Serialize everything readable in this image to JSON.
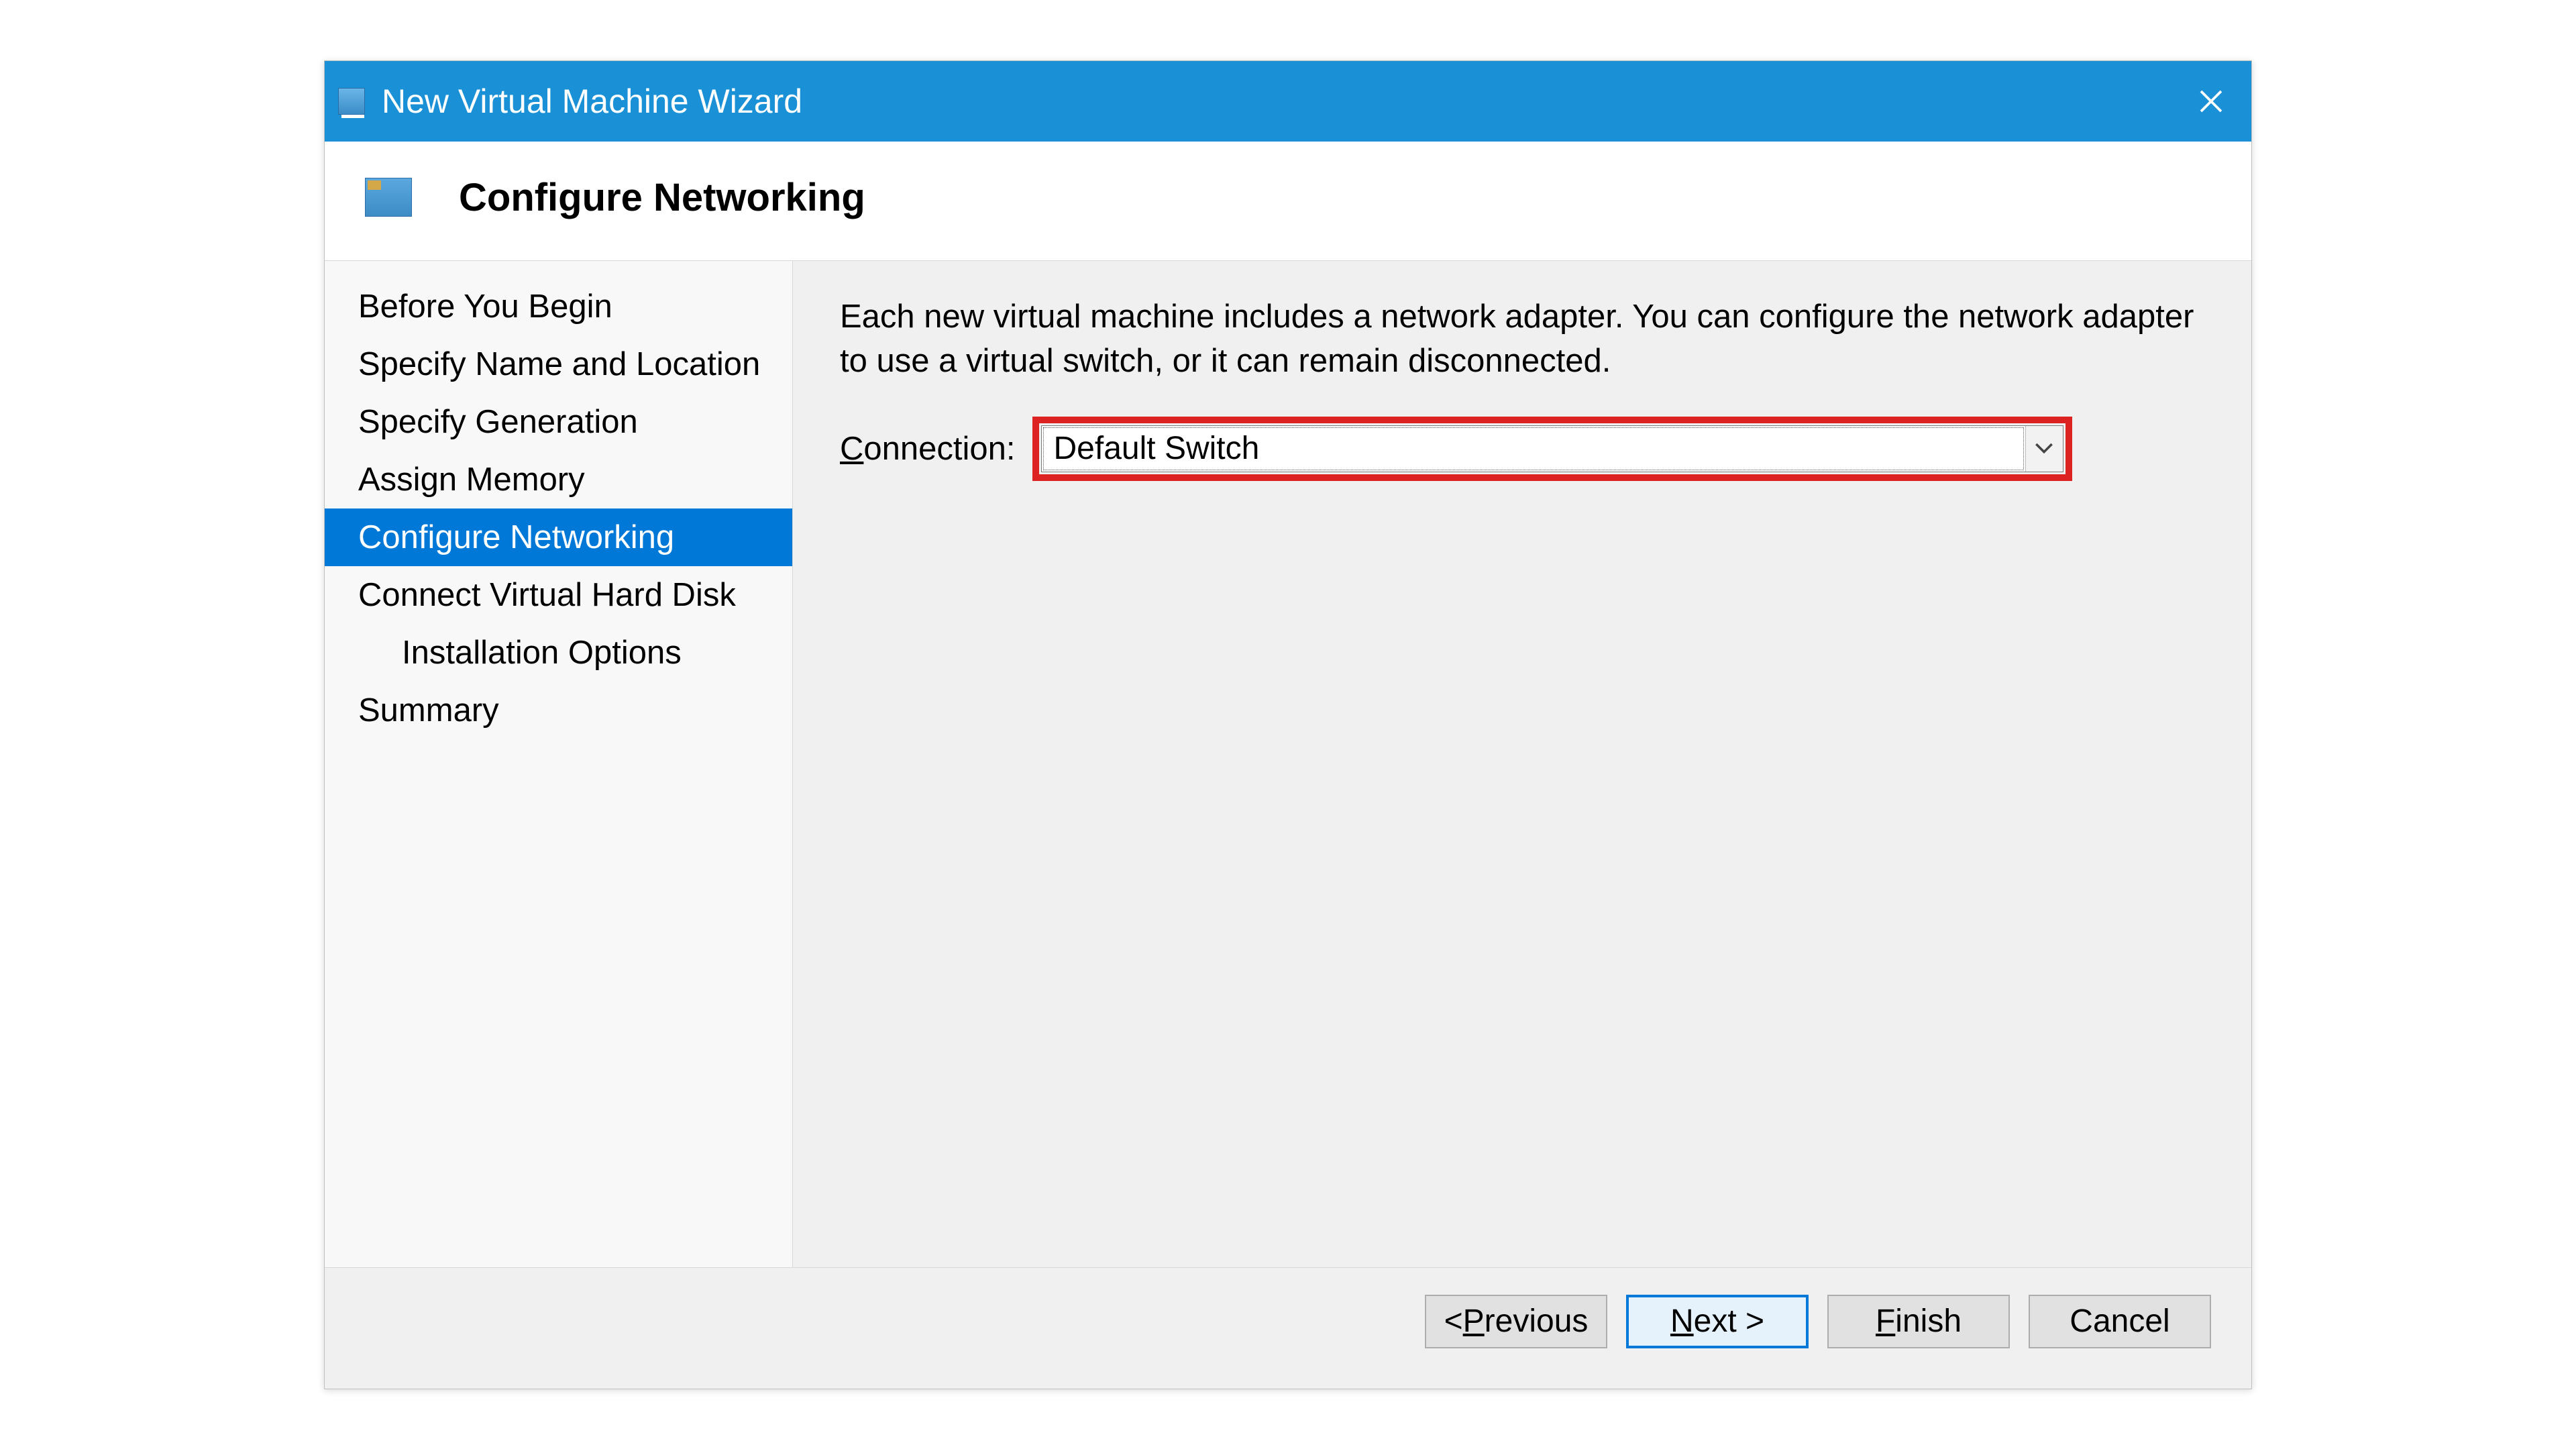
{
  "titlebar": {
    "title": "New Virtual Machine Wizard"
  },
  "header": {
    "title": "Configure Networking"
  },
  "sidebar": {
    "items": [
      {
        "label": "Before You Begin",
        "active": false,
        "indented": false
      },
      {
        "label": "Specify Name and Location",
        "active": false,
        "indented": false
      },
      {
        "label": "Specify Generation",
        "active": false,
        "indented": false
      },
      {
        "label": "Assign Memory",
        "active": false,
        "indented": false
      },
      {
        "label": "Configure Networking",
        "active": true,
        "indented": false
      },
      {
        "label": "Connect Virtual Hard Disk",
        "active": false,
        "indented": false
      },
      {
        "label": "Installation Options",
        "active": false,
        "indented": true
      },
      {
        "label": "Summary",
        "active": false,
        "indented": false
      }
    ]
  },
  "content": {
    "description": "Each new virtual machine includes a network adapter. You can configure the network adapter to use a virtual switch, or it can remain disconnected.",
    "connection_label_pre": "C",
    "connection_label_post": "onnection:",
    "connection_value": "Default Switch"
  },
  "footer": {
    "previous_pre": "< ",
    "previous_u": "P",
    "previous_post": "revious",
    "next_u": "N",
    "next_post": "ext >",
    "finish_u": "F",
    "finish_post": "inish",
    "cancel": "Cancel"
  }
}
